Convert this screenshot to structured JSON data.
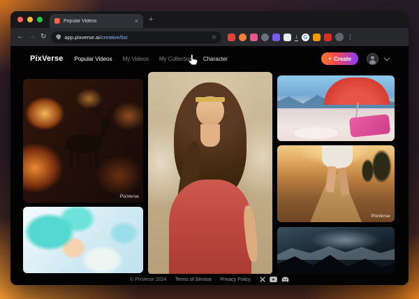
{
  "browser": {
    "window_controls": [
      "close",
      "minimize",
      "zoom"
    ],
    "tab": {
      "title": "Popular Videos",
      "close_glyph": "×"
    },
    "new_tab_glyph": "+",
    "toolbar": {
      "back_glyph": "←",
      "forward_glyph": "→",
      "reload_glyph": "↻",
      "url_domain": "app.pixverse.ai",
      "url_path": "/creative/list",
      "star_glyph": "☆",
      "download_glyph": "↓",
      "google_glyph": "G",
      "menu_glyph": "⋮"
    }
  },
  "site": {
    "logo": "PixVerse",
    "nav": [
      {
        "label": "Popular Videos",
        "state": "active"
      },
      {
        "label": "My Videos",
        "state": "default"
      },
      {
        "label": "My Collection",
        "state": "default"
      },
      {
        "label": "Character",
        "state": "hovered"
      }
    ],
    "create": {
      "label": "Create",
      "plus_glyph": "+"
    },
    "cards": [
      {
        "visual": "stag silhouette in burning forest with orange embers",
        "watermark": "PixVerse"
      },
      {
        "visual": "anime girl with teal hair on pale blue background",
        "watermark": ""
      },
      {
        "visual": "woman with gold laurel headband and red grecian dress",
        "watermark": ""
      },
      {
        "visual": "red beach umbrella over pink loungers with blue mountains",
        "watermark": ""
      },
      {
        "visual": "person walking away on sunset dirt road with cypress trees",
        "watermark": "PixVerse"
      },
      {
        "visual": "dark snowy mountain ridge at night",
        "watermark": ""
      }
    ],
    "footer": {
      "copyright": "© PixVerse 2024",
      "separator": "·",
      "terms_link": "Terms of Service",
      "privacy_link": "Privacy Policy",
      "social": [
        "x",
        "youtube",
        "discord"
      ]
    }
  },
  "colors": {
    "create_gradient_start": "#ff7a2a",
    "create_gradient_end": "#8a3bff",
    "site_background": "#030304",
    "browser_chrome": "#202124",
    "wallpaper_orange": "#e8821f"
  }
}
